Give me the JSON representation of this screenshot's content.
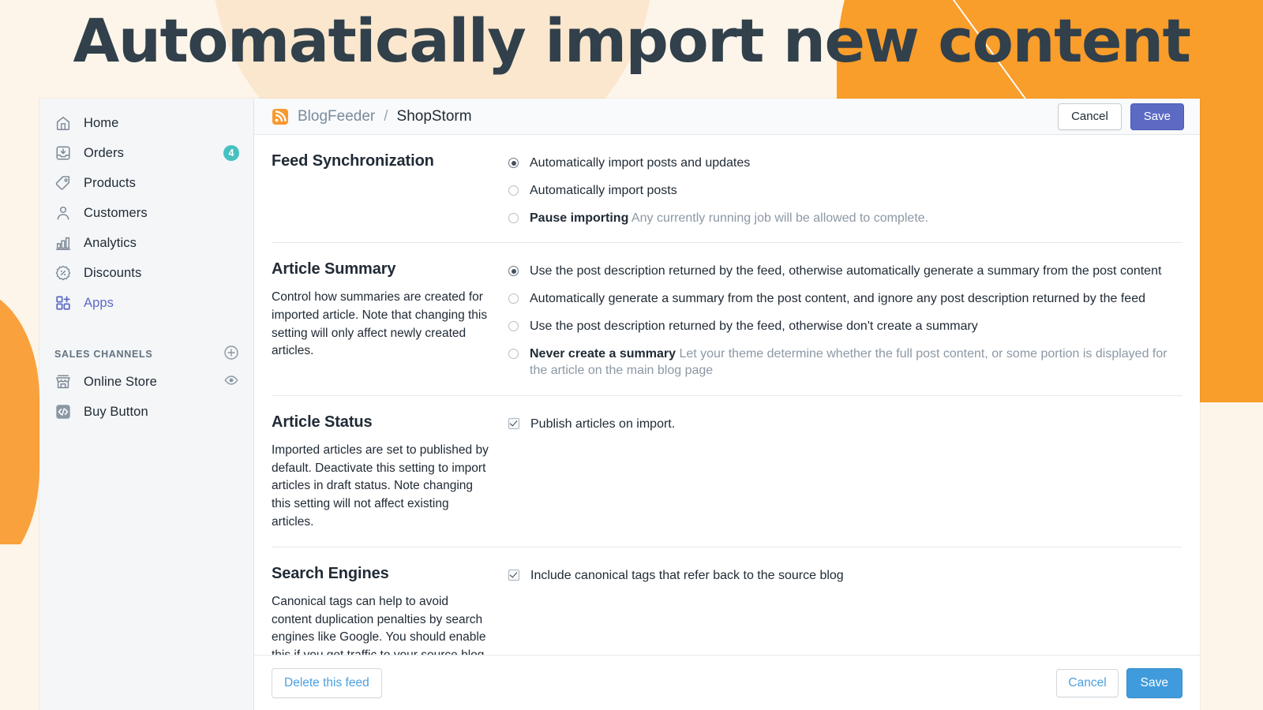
{
  "hero": {
    "title": "Automatically import new content"
  },
  "sidebar": {
    "items": [
      {
        "label": "Home",
        "icon": "home-icon",
        "badge": null
      },
      {
        "label": "Orders",
        "icon": "orders-inbox-icon",
        "badge": "4"
      },
      {
        "label": "Products",
        "icon": "tag-icon",
        "badge": null
      },
      {
        "label": "Customers",
        "icon": "person-icon",
        "badge": null
      },
      {
        "label": "Analytics",
        "icon": "bar-chart-icon",
        "badge": null
      },
      {
        "label": "Discounts",
        "icon": "discount-percent-icon",
        "badge": null
      },
      {
        "label": "Apps",
        "icon": "apps-grid-plus-icon",
        "badge": null
      }
    ],
    "section_title": "SALES CHANNELS",
    "section_action_icon": "plus-circle-icon",
    "channels": [
      {
        "label": "Online Store",
        "icon": "storefront-icon",
        "trailing_icon": "eye-icon"
      },
      {
        "label": "Buy Button",
        "icon": "code-tag-icon",
        "trailing_icon": null
      }
    ]
  },
  "topbar": {
    "feed_icon": "rss-feed-icon",
    "crumb_app": "BlogFeeder",
    "crumb_sep": "/",
    "crumb_store": "ShopStorm",
    "cancel_label": "Cancel",
    "save_label": "Save"
  },
  "sections": [
    {
      "title": "Feed Synchronization",
      "description": "",
      "control_type": "radio",
      "options": [
        {
          "selected": true,
          "label": "Automatically import posts and updates",
          "help": ""
        },
        {
          "selected": false,
          "label": "Automatically import posts",
          "help": ""
        },
        {
          "selected": false,
          "label": "Pause importing",
          "help": "Any currently running job will be allowed to complete."
        }
      ]
    },
    {
      "title": "Article Summary",
      "description": "Control how summaries are created for imported article. Note that changing this setting will only affect newly created articles.",
      "control_type": "radio",
      "options": [
        {
          "selected": true,
          "label": "Use the post description returned by the feed, otherwise automatically generate a summary from the post content",
          "help": ""
        },
        {
          "selected": false,
          "label": "Automatically generate a summary from the post content, and ignore any post description returned by the feed",
          "help": ""
        },
        {
          "selected": false,
          "label": "Use the post description returned by the feed, otherwise don't create a summary",
          "help": ""
        },
        {
          "selected": false,
          "label": "Never create a summary",
          "help": "Let your theme determine whether the full post content, or some portion is displayed for the article on the main blog page"
        }
      ]
    },
    {
      "title": "Article Status",
      "description": "Imported articles are set to published by default. Deactivate this setting to import articles in draft status. Note changing this setting will not affect existing articles.",
      "control_type": "checkbox",
      "options": [
        {
          "selected": true,
          "label": "Publish articles on import.",
          "help": ""
        }
      ]
    },
    {
      "title": "Search Engines",
      "description": "Canonical tags can help to avoid content duplication penalties by search engines like Google. You should enable this if you get traffic to your source blog.",
      "control_type": "checkbox",
      "options": [
        {
          "selected": true,
          "label": "Include canonical tags that refer back to the source blog",
          "help": ""
        }
      ]
    }
  ],
  "footer": {
    "delete_label": "Delete this feed",
    "cancel_label": "Cancel",
    "save_label": "Save"
  },
  "colors": {
    "accent_purple": "#5c6ac4",
    "accent_blue": "#3f9bdc",
    "badge_teal": "#47c1bf",
    "brand_orange": "#f99d2b",
    "page_bg": "#fdf5ea",
    "text": "#212b36",
    "muted": "#8c98a4"
  }
}
